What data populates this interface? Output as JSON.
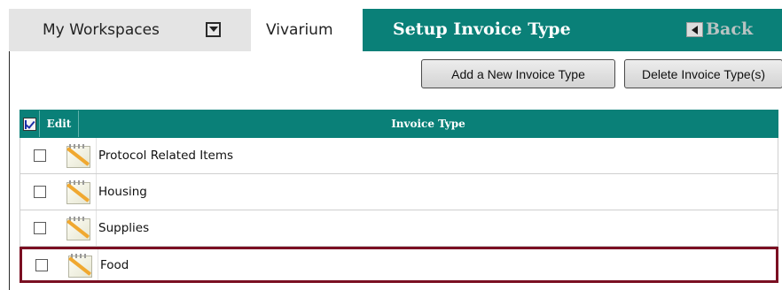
{
  "tabs": {
    "workspaces_label": "My Workspaces",
    "vivarium_label": "Vivarium"
  },
  "header": {
    "title": "Setup Invoice Type",
    "back_label": "Back"
  },
  "toolbar": {
    "add_label": "Add a New Invoice Type",
    "delete_label": "Delete Invoice Type(s)"
  },
  "grid": {
    "headers": {
      "select_all_icon": "select-all-icon",
      "edit": "Edit",
      "invoice_type": "Invoice Type"
    },
    "rows": [
      {
        "invoice_type": "Protocol Related Items",
        "checked": false
      },
      {
        "invoice_type": "Housing",
        "checked": false
      },
      {
        "invoice_type": "Supplies",
        "checked": false
      },
      {
        "invoice_type": "Food",
        "checked": false,
        "highlighted": true
      }
    ]
  },
  "colors": {
    "accent": "#0a8078",
    "highlight_border": "#7a0f22",
    "back_text": "#b9c3c2"
  }
}
